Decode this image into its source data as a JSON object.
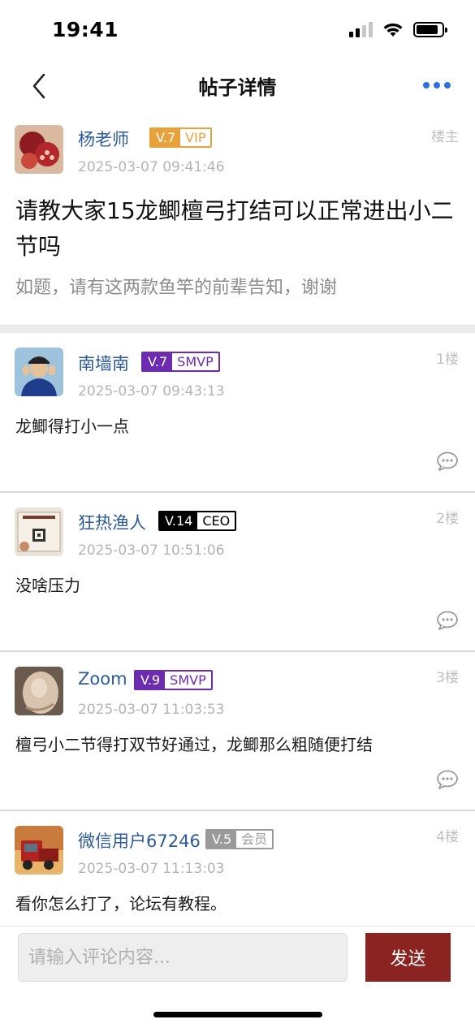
{
  "status_bar": {
    "time": "19:41",
    "battery_level": 0.85
  },
  "nav": {
    "title": "帖子详情",
    "back_icon": "chevron-left-icon",
    "more_icon": "more-dots-icon",
    "accent_color": "#2f6fe0"
  },
  "post": {
    "author": "杨老师",
    "level": "V.7",
    "tag": "VIP",
    "badge_color": "#e8a23c",
    "time": "2025-03-07 09:41:46",
    "floor": "楼主",
    "title": "请教大家15龙鲫檀弓打结可以正常进出小二节吗",
    "body": "如题，请有这两款鱼竿的前辈告知，谢谢"
  },
  "replies": [
    {
      "author": "南墙南",
      "level": "V.7",
      "tag": "SMVP",
      "badge_color": "#6d2bb0",
      "time": "2025-03-07 09:43:13",
      "floor": "1楼",
      "text": "龙鲫得打小一点"
    },
    {
      "author": "狂热渔人",
      "level": "V.14",
      "tag": "CEO",
      "badge_color": "#000000",
      "time": "2025-03-07 10:51:06",
      "floor": "2楼",
      "text": "没啥压力"
    },
    {
      "author": "Zoom",
      "level": "V.9",
      "tag": "SMVP",
      "badge_color": "#6d2bb0",
      "time": "2025-03-07 11:03:53",
      "floor": "3楼",
      "text": "檀弓小二节得打双节好通过，龙鲫那么粗随便打结"
    },
    {
      "author": "微信用户67246",
      "level": "V.5",
      "tag": "会员",
      "badge_color": "#9a9a9a",
      "time": "2025-03-07 11:13:03",
      "floor": "4楼",
      "text": "看你怎么打了，论坛有教程。"
    }
  ],
  "input": {
    "placeholder": "请输入评论内容...",
    "send_label": "发送",
    "send_color": "#8b2320"
  }
}
